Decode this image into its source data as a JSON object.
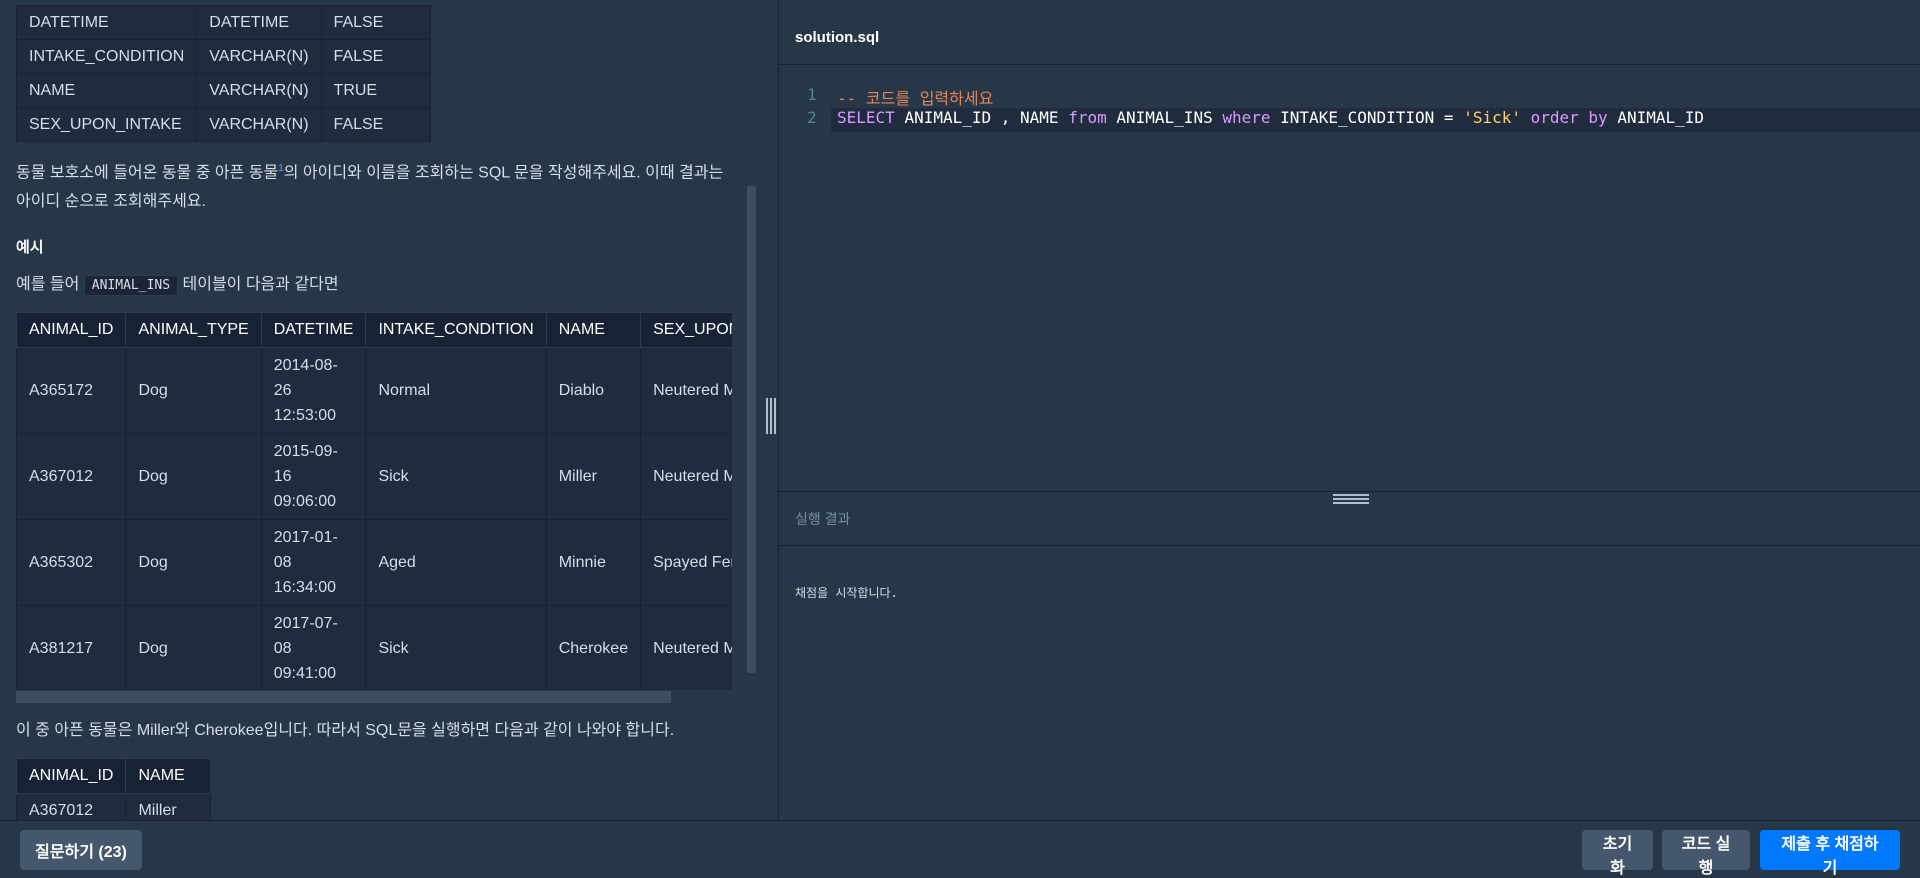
{
  "schema": {
    "rows": [
      [
        "DATETIME",
        "DATETIME",
        "FALSE"
      ],
      [
        "INTAKE_CONDITION",
        "VARCHAR(N)",
        "FALSE"
      ],
      [
        "NAME",
        "VARCHAR(N)",
        "TRUE"
      ],
      [
        "SEX_UPON_INTAKE",
        "VARCHAR(N)",
        "FALSE"
      ]
    ]
  },
  "problem": {
    "line1_a": "동물 보호소에 들어온 동물 중 아픈 동물",
    "footnote": "1",
    "line1_b": "의 아이디와 이름을 조회하는 SQL 문을 작성해주세요. 이때 결과는",
    "line2": "아이디 순으로 조회해주세요.",
    "example_heading": "예시",
    "example_intro_a": "예를 들어",
    "example_table_name": "ANIMAL_INS",
    "example_intro_b": "테이블이 다음과 같다면",
    "conclusion": "이 중 아픈 동물은 Miller와 Cherokee입니다. 따라서 SQL문을 실행하면 다음과 같이 나와야 합니다."
  },
  "example_table": {
    "headers": [
      "ANIMAL_ID",
      "ANIMAL_TYPE",
      "DATETIME",
      "INTAKE_CONDITION",
      "NAME",
      "SEX_UPON_"
    ],
    "rows": [
      [
        "A365172",
        "Dog",
        "2014-08-",
        "26",
        "12:53:00",
        "Normal",
        "Diablo",
        "Neutered M"
      ],
      [
        "A367012",
        "Dog",
        "2015-09-",
        "16",
        "09:06:00",
        "Sick",
        "Miller",
        "Neutered M"
      ],
      [
        "A365302",
        "Dog",
        "2017-01-",
        "08",
        "16:34:00",
        "Aged",
        "Minnie",
        "Spayed Fem"
      ],
      [
        "A381217",
        "Dog",
        "2017-07-",
        "08",
        "09:41:00",
        "Sick",
        "Cherokee",
        "Neutered M"
      ]
    ]
  },
  "result_table": {
    "headers": [
      "ANIMAL_ID",
      "NAME"
    ],
    "rows": [
      [
        "A367012",
        "Miller"
      ]
    ]
  },
  "editor": {
    "filename": "solution.sql",
    "line_numbers": [
      "1",
      "2"
    ],
    "comment": "-- 코드를 입력하세요",
    "tokens": {
      "select": "SELECT",
      "cols": "ANIMAL_ID , NAME",
      "from": "from",
      "table": "ANIMAL_INS",
      "where": "where",
      "cond_col": "INTAKE_CONDITION =",
      "value": "'Sick'",
      "order_by": "order by",
      "order_col": "ANIMAL_ID"
    }
  },
  "result_panel": {
    "title": "실행 결과",
    "message": "채점을 시작합니다."
  },
  "buttons": {
    "ask": "질문하기 (23)",
    "reset": "초기화",
    "run": "코드 실행",
    "submit": "제출 후 채점하기"
  }
}
